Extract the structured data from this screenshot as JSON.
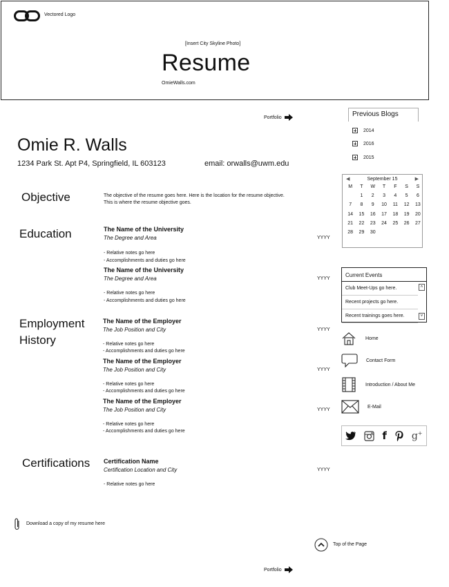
{
  "header": {
    "logo_text": "Vectored Logo",
    "photo_placeholder": "[Insert City Skyline Photo]",
    "title": "Resume",
    "site": "OmieWalls.com"
  },
  "portfolio_label": "Portfolio",
  "profile": {
    "name": "Omie R. Walls",
    "address": "1234 Park St. Apt P4, Springfield, IL 603123",
    "email": "email: orwalls@uwm.edu"
  },
  "objective": {
    "heading": "Objective",
    "text_line1": "The objective of the resume goes here. Here is the location for the resume objective.",
    "text_line2": "This is where the resume objective goes."
  },
  "education": {
    "heading": "Education",
    "entries": [
      {
        "name": "The Name of the University",
        "sub": "The Degree and Area",
        "year": "YYYY",
        "note1": "- Relative notes go here",
        "note2": "- Accomplishments and duties go here"
      },
      {
        "name": "The Name of the University",
        "sub": "The Degree and Area",
        "year": "YYYY",
        "note1": "- Relative notes go here",
        "note2": "- Accomplishments and duties go here"
      }
    ]
  },
  "employment": {
    "heading_line1": "Employment",
    "heading_line2": "History",
    "entries": [
      {
        "name": "The Name of the Employer",
        "sub": "The Job Position and City",
        "year": "YYYY",
        "note1": "- Relative notes go here",
        "note2": "- Accomplishments and duties go here"
      },
      {
        "name": "The Name of the Employer",
        "sub": "The Job Position and City",
        "year": "YYYY",
        "note1": "- Relative notes go here",
        "note2": "- Accomplishments and duties go here"
      },
      {
        "name": "The Name of the Employer",
        "sub": "The Job Position and City",
        "year": "YYYY",
        "note1": "- Relative notes go here",
        "note2": "- Accomplishments and duties go here"
      }
    ]
  },
  "certifications": {
    "heading": "Certifications",
    "name": "Certification Name",
    "sub": "Certification Location and City",
    "year": "YYYY",
    "note1": "- Relative notes go here"
  },
  "download_label": "Download a copy of my resume here",
  "top_label": "Top of the Page",
  "sidebar": {
    "blogs_title": "Previous Blogs",
    "years": [
      "2014",
      "2016",
      "2015"
    ],
    "calendar": {
      "month": "September 15",
      "weekdays": [
        "M",
        "T",
        "W",
        "T",
        "F",
        "S",
        "S"
      ],
      "days": [
        "",
        "1",
        "2",
        "3",
        "4",
        "5",
        "6",
        "7",
        "8",
        "9",
        "10",
        "11",
        "12",
        "13",
        "14",
        "15",
        "16",
        "17",
        "18",
        "19",
        "20",
        "21",
        "22",
        "23",
        "24",
        "25",
        "26",
        "27",
        "28",
        "29",
        "30"
      ]
    },
    "events_title": "Current Events",
    "events": [
      "Club Meet-Ups go here.",
      "Recent projects go here.",
      "Recent trainings goes here."
    ],
    "nav": {
      "home": "Home",
      "contact": "Contact Form",
      "intro": "Introduction / About Me",
      "email": "E-Mail"
    },
    "social": [
      "twitter-icon",
      "instagram-icon",
      "facebook-icon",
      "pinterest-icon",
      "google-plus-icon"
    ]
  }
}
